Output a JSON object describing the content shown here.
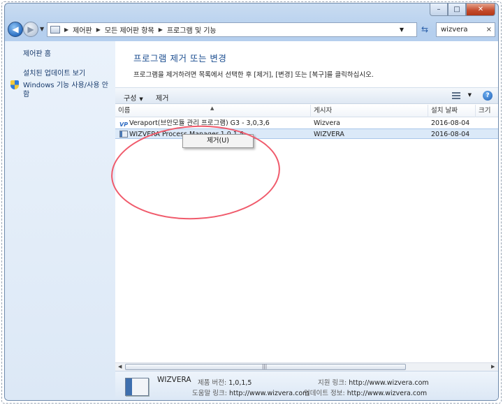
{
  "window": {
    "caption_buttons": {
      "minimize": "–",
      "maximize": "□",
      "close": "✕"
    }
  },
  "address_bar": {
    "breadcrumbs": [
      "제어판",
      "모든 제어판 항목",
      "프로그램 및 기능"
    ],
    "search_value": "wizvera",
    "search_clear": "×"
  },
  "sidebar": {
    "links": [
      {
        "label": "제어판 홈"
      },
      {
        "label": "설치된 업데이트 보기"
      },
      {
        "label": "Windows 기능 사용/사용 안 함"
      }
    ]
  },
  "main": {
    "title": "프로그램 제거 또는 변경",
    "description": "프로그램을 제거하려면 목록에서 선택한 후 [제거], [변경] 또는 [복구]를 클릭하십시오."
  },
  "toolbar": {
    "organize_label": "구성",
    "uninstall_label": "제거",
    "help_label": "?"
  },
  "list": {
    "columns": [
      "이름",
      "게시자",
      "설치 날짜",
      "크기"
    ],
    "rows": [
      {
        "name": "Veraport(브안모듈 관리 프로그램) G3 - 3,0,3,6",
        "publisher": "Wizvera",
        "date": "2016-08-04",
        "icon": "veraport-icon"
      },
      {
        "name": "WIZVERA Process Manager 1,0,1,5",
        "publisher": "WIZVERA",
        "date": "2016-08-04",
        "icon": "app-window-icon",
        "selected": true
      }
    ]
  },
  "context_menu": {
    "items": [
      {
        "label": "제거(U)"
      }
    ]
  },
  "details": {
    "publisher": "WIZVERA",
    "product_version_label": "제품 버전:",
    "product_version": "1,0,1,5",
    "support_link_label": "지원 링크:",
    "support_link": "http://www.wizvera.com",
    "help_link_label": "도움말 링크:",
    "help_link": "http://www.wizvera.com",
    "update_info_label": "업데이트 정보:",
    "update_info": "http://www.wizvera.com"
  },
  "colors": {
    "title_blue": "#1d4f91",
    "annotation_red": "#f05a6b",
    "selection": "#dbe9f8"
  }
}
